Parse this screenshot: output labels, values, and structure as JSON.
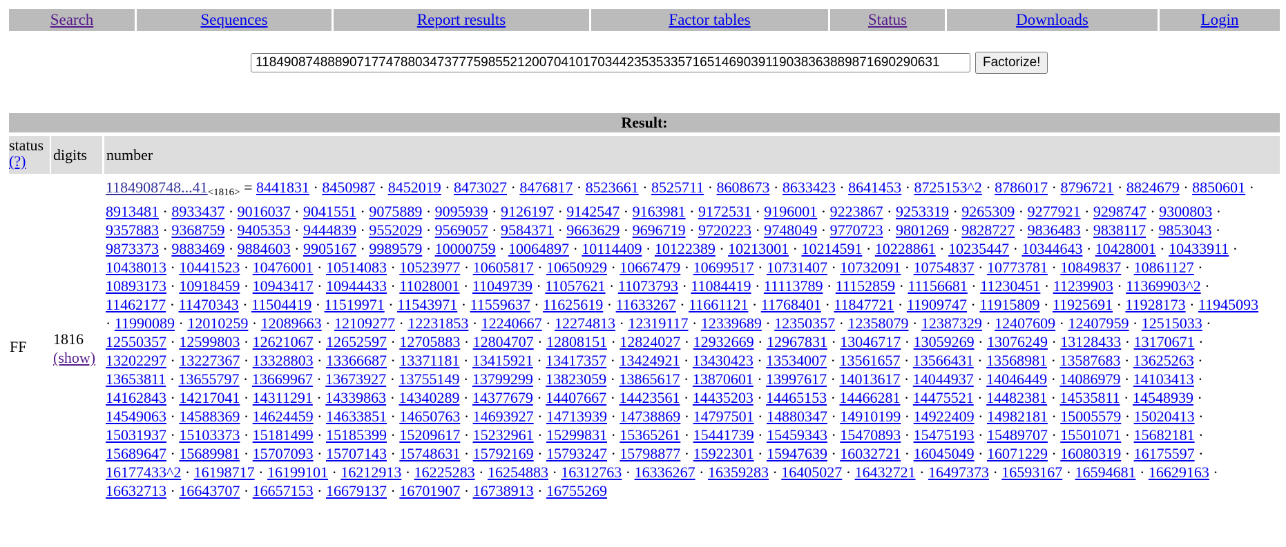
{
  "nav": {
    "items": [
      "Search",
      "Sequences",
      "Report results",
      "Factor tables",
      "Status",
      "Downloads",
      "Login"
    ]
  },
  "search": {
    "value": "1184908748889071774788034737775985521200704101703442353533571651469039119038363889871690290631",
    "button_label": "Factorize!"
  },
  "result": {
    "title": "Result:",
    "headers": {
      "status": "status",
      "status_help": "(?)",
      "digits": "digits",
      "number": "number"
    },
    "status": "FF",
    "digits": "1816",
    "show_label": "(show)",
    "number_short": "1184908748...41",
    "number_digits": "<1816>",
    "equals": "=",
    "separator": "·",
    "factors": [
      "8441831",
      "8450987",
      "8452019",
      "8473027",
      "8476817",
      "8523661",
      "8525711",
      "8608673",
      "8633423",
      "8641453",
      "8725153^2",
      "8786017",
      "8796721",
      "8824679",
      "8850601",
      "8913481",
      "8933437",
      "9016037",
      "9041551",
      "9075889",
      "9095939",
      "9126197",
      "9142547",
      "9163981",
      "9172531",
      "9196001",
      "9223867",
      "9253319",
      "9265309",
      "9277921",
      "9298747",
      "9300803",
      "9357883",
      "9368759",
      "9405353",
      "9444839",
      "9552029",
      "9569057",
      "9584371",
      "9663629",
      "9696719",
      "9720223",
      "9748049",
      "9770723",
      "9801269",
      "9828727",
      "9836483",
      "9838117",
      "9853043",
      "9873373",
      "9883469",
      "9884603",
      "9905167",
      "9989579",
      "10000759",
      "10064897",
      "10114409",
      "10122389",
      "10213001",
      "10214591",
      "10228861",
      "10235447",
      "10344643",
      "10428001",
      "10433911",
      "10438013",
      "10441523",
      "10476001",
      "10514083",
      "10523977",
      "10605817",
      "10650929",
      "10667479",
      "10699517",
      "10731407",
      "10732091",
      "10754837",
      "10773781",
      "10849837",
      "10861127",
      "10893173",
      "10918459",
      "10943417",
      "10944433",
      "11028001",
      "11049739",
      "11057621",
      "11073793",
      "11084419",
      "11113789",
      "11152859",
      "11156681",
      "11230451",
      "11239903",
      "11369903^2",
      "11462177",
      "11470343",
      "11504419",
      "11519971",
      "11543971",
      "11559637",
      "11625619",
      "11633267",
      "11661121",
      "11768401",
      "11847721",
      "11909747",
      "11915809",
      "11925691",
      "11928173",
      "11945093",
      "11990089",
      "12010259",
      "12089663",
      "12109277",
      "12231853",
      "12240667",
      "12274813",
      "12319117",
      "12339689",
      "12350357",
      "12358079",
      "12387329",
      "12407609",
      "12407959",
      "12515033",
      "12550357",
      "12599803",
      "12621067",
      "12652597",
      "12705883",
      "12804707",
      "12808151",
      "12824027",
      "12932669",
      "12967831",
      "13046717",
      "13059269",
      "13076249",
      "13128433",
      "13170671",
      "13202297",
      "13227367",
      "13328803",
      "13366687",
      "13371181",
      "13415921",
      "13417357",
      "13424921",
      "13430423",
      "13534007",
      "13561657",
      "13566431",
      "13568981",
      "13587683",
      "13625263",
      "13653811",
      "13655797",
      "13669967",
      "13673927",
      "13755149",
      "13799299",
      "13823059",
      "13865617",
      "13870601",
      "13997617",
      "14013617",
      "14044937",
      "14046449",
      "14086979",
      "14103413",
      "14162843",
      "14217041",
      "14311291",
      "14339863",
      "14340289",
      "14377679",
      "14407667",
      "14423561",
      "14435203",
      "14465153",
      "14466281",
      "14475521",
      "14482381",
      "14535811",
      "14548939",
      "14549063",
      "14588369",
      "14624459",
      "14633851",
      "14650763",
      "14693927",
      "14713939",
      "14738869",
      "14797501",
      "14880347",
      "14910199",
      "14922409",
      "14982181",
      "15005579",
      "15020413",
      "15031937",
      "15103373",
      "15181499",
      "15185399",
      "15209617",
      "15232961",
      "15299831",
      "15365261",
      "15441739",
      "15459343",
      "15470893",
      "15475193",
      "15489707",
      "15501071",
      "15682181",
      "15689647",
      "15689981",
      "15707093",
      "15707143",
      "15748631",
      "15792169",
      "15793247",
      "15798877",
      "15922301",
      "15947639",
      "16032721",
      "16045049",
      "16071229",
      "16080319",
      "16175597",
      "16177433^2",
      "16198717",
      "16199101",
      "16212913",
      "16225283",
      "16254883",
      "16312763",
      "16336267",
      "16359283",
      "16405027",
      "16432721",
      "16497373",
      "16593167",
      "16594681",
      "16629163",
      "16632713",
      "16643707",
      "16657153",
      "16679137",
      "16701907",
      "16738913",
      "16755269"
    ]
  },
  "colors": {
    "nav_bg": "#bbbbbb",
    "header_bg": "#dddddd",
    "link": "#0000ee",
    "visited": "#551a8b"
  }
}
